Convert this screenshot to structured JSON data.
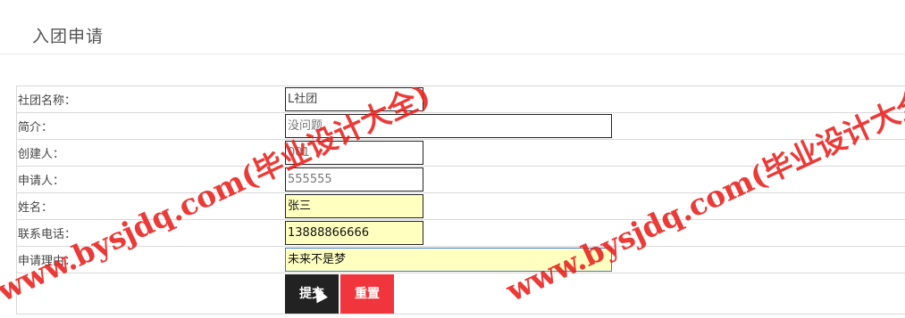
{
  "page": {
    "title": "入团申请"
  },
  "form": {
    "rows": [
      {
        "label": "社团名称：",
        "value": "L社团"
      },
      {
        "label": "简介：",
        "value": "没问题"
      },
      {
        "label": "创建人：",
        "value": "001"
      },
      {
        "label": "申请人：",
        "value": "555555"
      },
      {
        "label": "姓名：",
        "value": "张三"
      },
      {
        "label": "联系电话：",
        "value": "13888866666"
      },
      {
        "label": "申请理由：",
        "value": "未来不是梦"
      }
    ],
    "submit_label": "提交",
    "reset_label": "重置"
  },
  "watermark": {
    "text": "www.bysjdq.com(毕业设计大全)",
    "color": "#e8211d"
  },
  "colors": {
    "autofill": "#ffffc0",
    "submit": "#222222",
    "reset": "#f0353c"
  }
}
